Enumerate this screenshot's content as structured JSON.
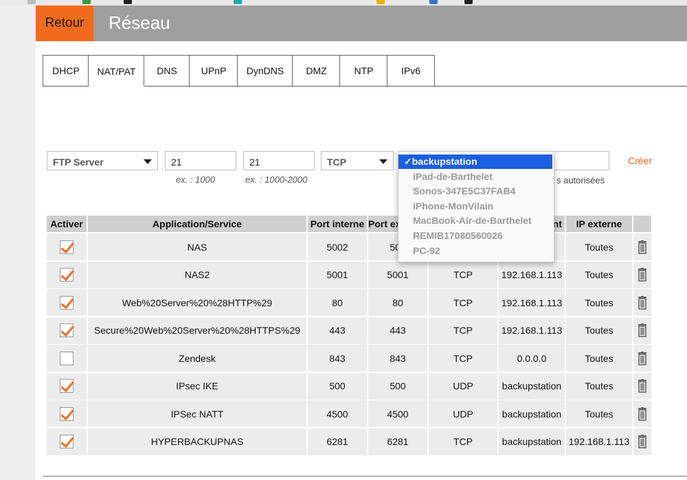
{
  "header": {
    "back_label": "Retour",
    "title": "Réseau"
  },
  "tabs": [
    {
      "label": "DHCP"
    },
    {
      "label": "NAT/PAT",
      "active": true
    },
    {
      "label": "DNS"
    },
    {
      "label": "UPnP"
    },
    {
      "label": "DynDNS"
    },
    {
      "label": "DMZ"
    },
    {
      "label": "NTP"
    },
    {
      "label": "IPv6"
    }
  ],
  "form": {
    "service_value": "FTP Server",
    "internal_port_value": "21",
    "external_port_value": "21",
    "protocol_value": "TCP",
    "internal_port_hint": "ex. : 1000",
    "external_port_hint": "ex. : 1000-2000",
    "allowed_text": "s autorisées",
    "create_label": "Créer"
  },
  "dropdown": {
    "options": [
      {
        "label": "✓backupstation",
        "selected": true
      },
      {
        "label": "iPad-de-Barthelet"
      },
      {
        "label": "Sonos-347E5C37FAB4"
      },
      {
        "label": "iPhone-MonVilain"
      },
      {
        "label": "MacBook-Air-de-Barthelet"
      },
      {
        "label": "REMIB17080560026"
      },
      {
        "label": "PC-92"
      }
    ]
  },
  "table": {
    "headers": [
      "Activer",
      "Application/Service",
      "Port interne",
      "Port ex",
      "",
      "nt",
      "IP externe",
      ""
    ],
    "rows": [
      {
        "active": true,
        "app": "NAS",
        "internal": "5002",
        "external": "500",
        "protocol": "",
        "device": "113",
        "external_ip": "Toutes"
      },
      {
        "active": true,
        "app": "NAS2",
        "internal": "5001",
        "external": "5001",
        "protocol": "TCP",
        "device": "192.168.1.113",
        "external_ip": "Toutes"
      },
      {
        "active": true,
        "app": "Web%20Server%20%28HTTP%29",
        "internal": "80",
        "external": "80",
        "protocol": "TCP",
        "device": "192.168.1.113",
        "external_ip": "Toutes"
      },
      {
        "active": true,
        "app": "Secure%20Web%20Server%20%28HTTPS%29",
        "internal": "443",
        "external": "443",
        "protocol": "TCP",
        "device": "192.168.1.113",
        "external_ip": "Toutes"
      },
      {
        "active": false,
        "app": "Zendesk",
        "internal": "843",
        "external": "843",
        "protocol": "TCP",
        "device": "0.0.0.0",
        "external_ip": "Toutes"
      },
      {
        "active": true,
        "app": "IPsec IKE",
        "internal": "500",
        "external": "500",
        "protocol": "UDP",
        "device": "backupstation",
        "external_ip": "Toutes"
      },
      {
        "active": true,
        "app": "IPSec NATT",
        "internal": "4500",
        "external": "4500",
        "protocol": "UDP",
        "device": "backupstation",
        "external_ip": "Toutes"
      },
      {
        "active": true,
        "app": "HYPERBACKUPNAS",
        "internal": "6281",
        "external": "6281",
        "protocol": "TCP",
        "device": "backupstation",
        "external_ip": "192.168.1.113"
      }
    ]
  },
  "colors": {
    "accent": "#f26b1d",
    "header_bg": "#9f9f9f",
    "selection": "#1a5fe0",
    "cell_bg": "#ececec"
  }
}
